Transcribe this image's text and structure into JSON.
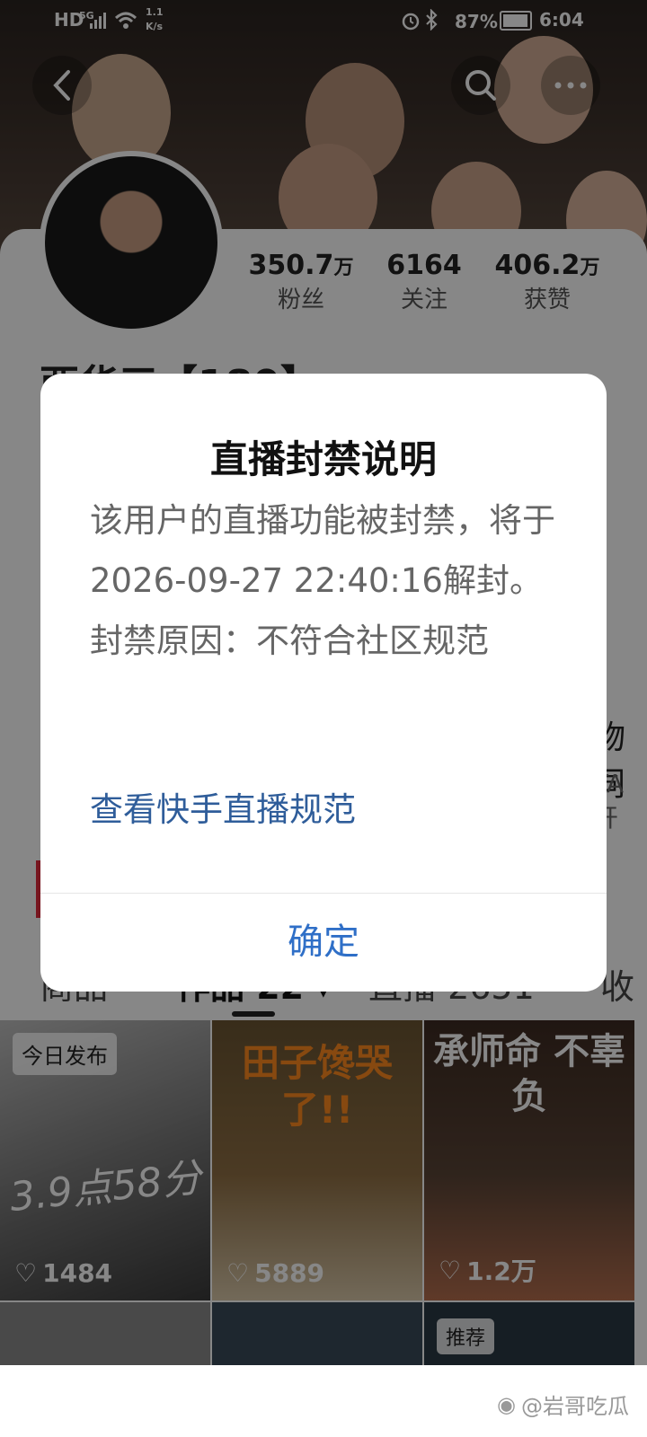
{
  "status_bar": {
    "network": "5G",
    "speed_value": "1.1",
    "speed_unit": "K/s",
    "battery": "87%",
    "time": "6:04"
  },
  "profile": {
    "stats": [
      {
        "num": "350.7",
        "unit": "万",
        "label": "粉丝"
      },
      {
        "num": "6164",
        "unit": "",
        "label": "关注"
      },
      {
        "num": "406.2",
        "unit": "万",
        "label": "获赞"
      }
    ],
    "name_partial": "西华三【180】",
    "side_text_1": "物同",
    "side_text_2": "TA开"
  },
  "tabs": [
    {
      "label": "商品"
    },
    {
      "label": "作品 22"
    },
    {
      "label": "直播 2651"
    },
    {
      "label": "收"
    }
  ],
  "grid": [
    {
      "badge": "今日发布",
      "overlay_text": "3.9点58分",
      "likes": "1484"
    },
    {
      "badge": "",
      "overlay_text": "田子馋哭了!!",
      "likes": "5889"
    },
    {
      "badge": "",
      "overlay_text": "承师命 不辜负",
      "likes": "1.2万"
    }
  ],
  "row2_badge": "推荐",
  "dialog": {
    "title": "直播封禁说明",
    "body": "该用户的直播功能被封禁，将于2026-09-27 22:40:16解封。\n封禁原因：不符合社区规范",
    "link": "查看快手直播规范",
    "confirm": "确定"
  },
  "watermark": "@岩哥吃瓜",
  "colors": {
    "link": "#2f5d9a",
    "confirm": "#2f6fc7",
    "overlay": "rgba(0,0,0,0.47)"
  }
}
